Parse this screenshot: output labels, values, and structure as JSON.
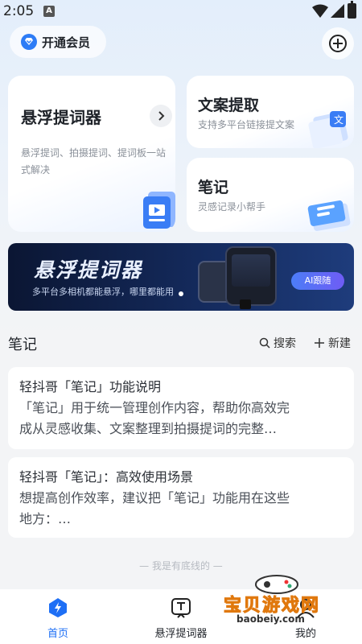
{
  "status_bar": {
    "time": "2:05",
    "notification_badge": "A"
  },
  "header": {
    "vip_label": "开通会员"
  },
  "features": {
    "prompter": {
      "title": "悬浮提词器",
      "desc": "悬浮提词、拍摄提词、提词板一站式解决"
    },
    "copy_extract": {
      "title": "文案提取",
      "desc": "支持多平台链接提文案"
    },
    "notes": {
      "title": "笔记",
      "desc": "灵感记录小帮手"
    }
  },
  "banner": {
    "title": "悬浮提词器",
    "subtitle": "多平台多相机都能悬浮，哪里都能用",
    "pill": "AI跟随"
  },
  "notes_section": {
    "title": "笔记",
    "search_label": "搜索",
    "new_label": "新建",
    "items": [
      {
        "title": "轻抖哥「笔记」功能说明",
        "body_line1": "「笔记」用于统一管理创作内容，帮助你高效完",
        "body_line2": "成从灵感收集、文案整理到拍摄提词的完整…"
      },
      {
        "title": "轻抖哥「笔记」：高效使用场景",
        "body_line1": "想提高创作效率，建议把「笔记」功能用在这些",
        "body_line2": "地方：…"
      }
    ],
    "end_text": "— 我是有底线的 —"
  },
  "tabbar": {
    "home": "首页",
    "prompter": "悬浮提词器",
    "mine": "我的"
  },
  "watermark": {
    "text": "宝贝游戏网",
    "url": "baobeiy.com"
  },
  "colors": {
    "accent": "#1e6ff5",
    "banner_bg": "#0b1633"
  }
}
